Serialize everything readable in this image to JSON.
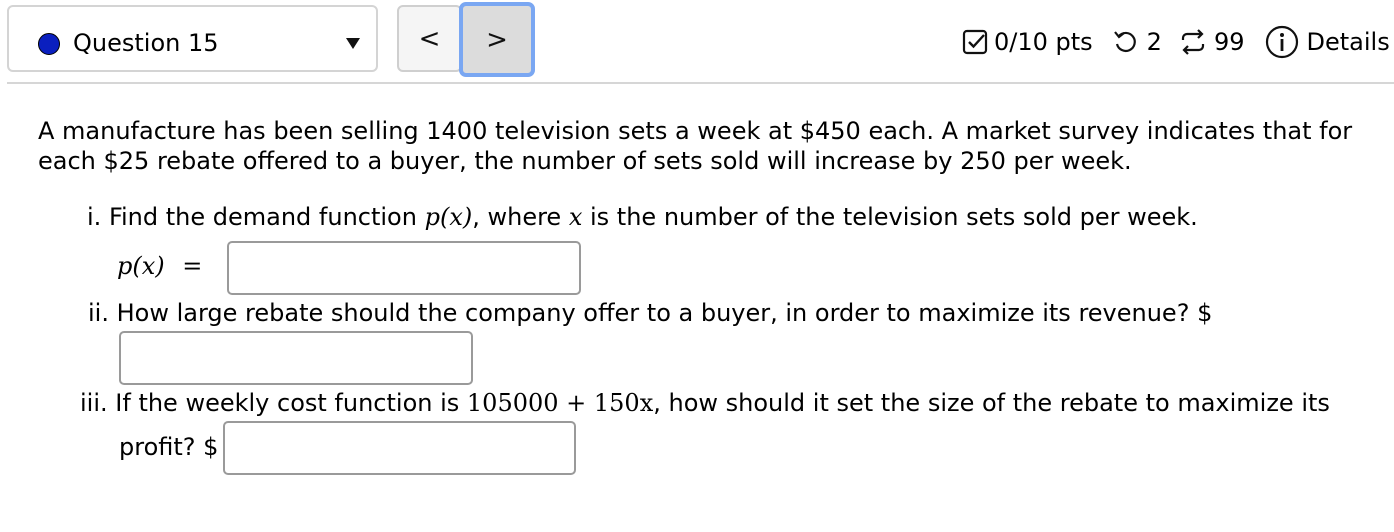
{
  "header": {
    "question_label": "Question 15",
    "prev_label": "<",
    "next_label": ">",
    "points": "0/10 pts",
    "retries": "2",
    "attempts": "99",
    "details": "Details"
  },
  "problem": {
    "intro_line1": "A manufacture has been selling 1400 television sets a week at $450 each. A market survey indicates that for",
    "intro_line2": "each $25 rebate offered to a buyer, the number of sets sold will increase by 250 per week.",
    "parts": [
      {
        "numeral": "i.",
        "text_a": "Find the demand function ",
        "math_a": "p(x)",
        "text_b": ", where ",
        "math_b": "x",
        "text_c": " is the number of the television sets sold per week.",
        "answer_lhs": "p(x)",
        "answer_eq": "=",
        "input_value": ""
      },
      {
        "numeral": "ii.",
        "text": "How large rebate should the company offer to a buyer, in order to maximize its revenue? $",
        "input_value": ""
      },
      {
        "numeral": "iii.",
        "text_a": "If the weekly cost function is ",
        "math": "105000 + 150x",
        "text_b": ", how should it set the size of the rebate to maximize its",
        "text_c": "profit? $",
        "input_value": ""
      }
    ]
  },
  "icons": {
    "dot_color": "#0a1fbf",
    "focus_color": "#7aa7f2"
  }
}
